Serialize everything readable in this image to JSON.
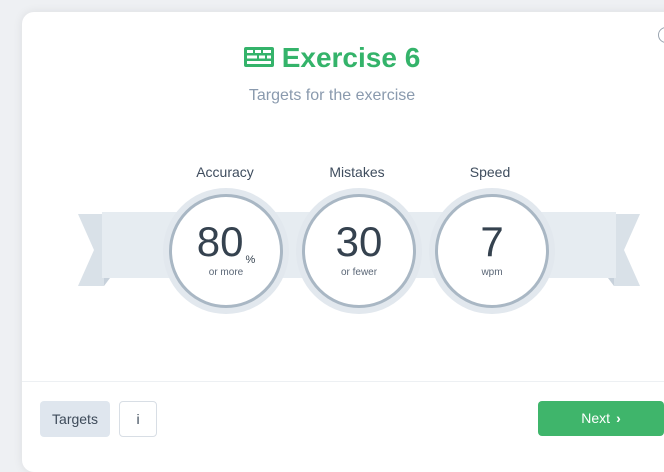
{
  "header": {
    "title": "Exercise 6",
    "subtitle": "Targets for the exercise",
    "icon": "keyboard-icon"
  },
  "targets": {
    "accuracy": {
      "label": "Accuracy",
      "value": "80",
      "unit": "%",
      "note": "or more"
    },
    "mistakes": {
      "label": "Mistakes",
      "value": "30",
      "note": "or fewer"
    },
    "speed": {
      "label": "Speed",
      "value": "7",
      "note": "wpm"
    }
  },
  "footer": {
    "targets_label": "Targets",
    "info_label": "i",
    "next_label": "Next"
  },
  "colors": {
    "accent_green": "#3fb56b",
    "text_dark": "#35424f",
    "ribbon": "#e2e8ee"
  }
}
